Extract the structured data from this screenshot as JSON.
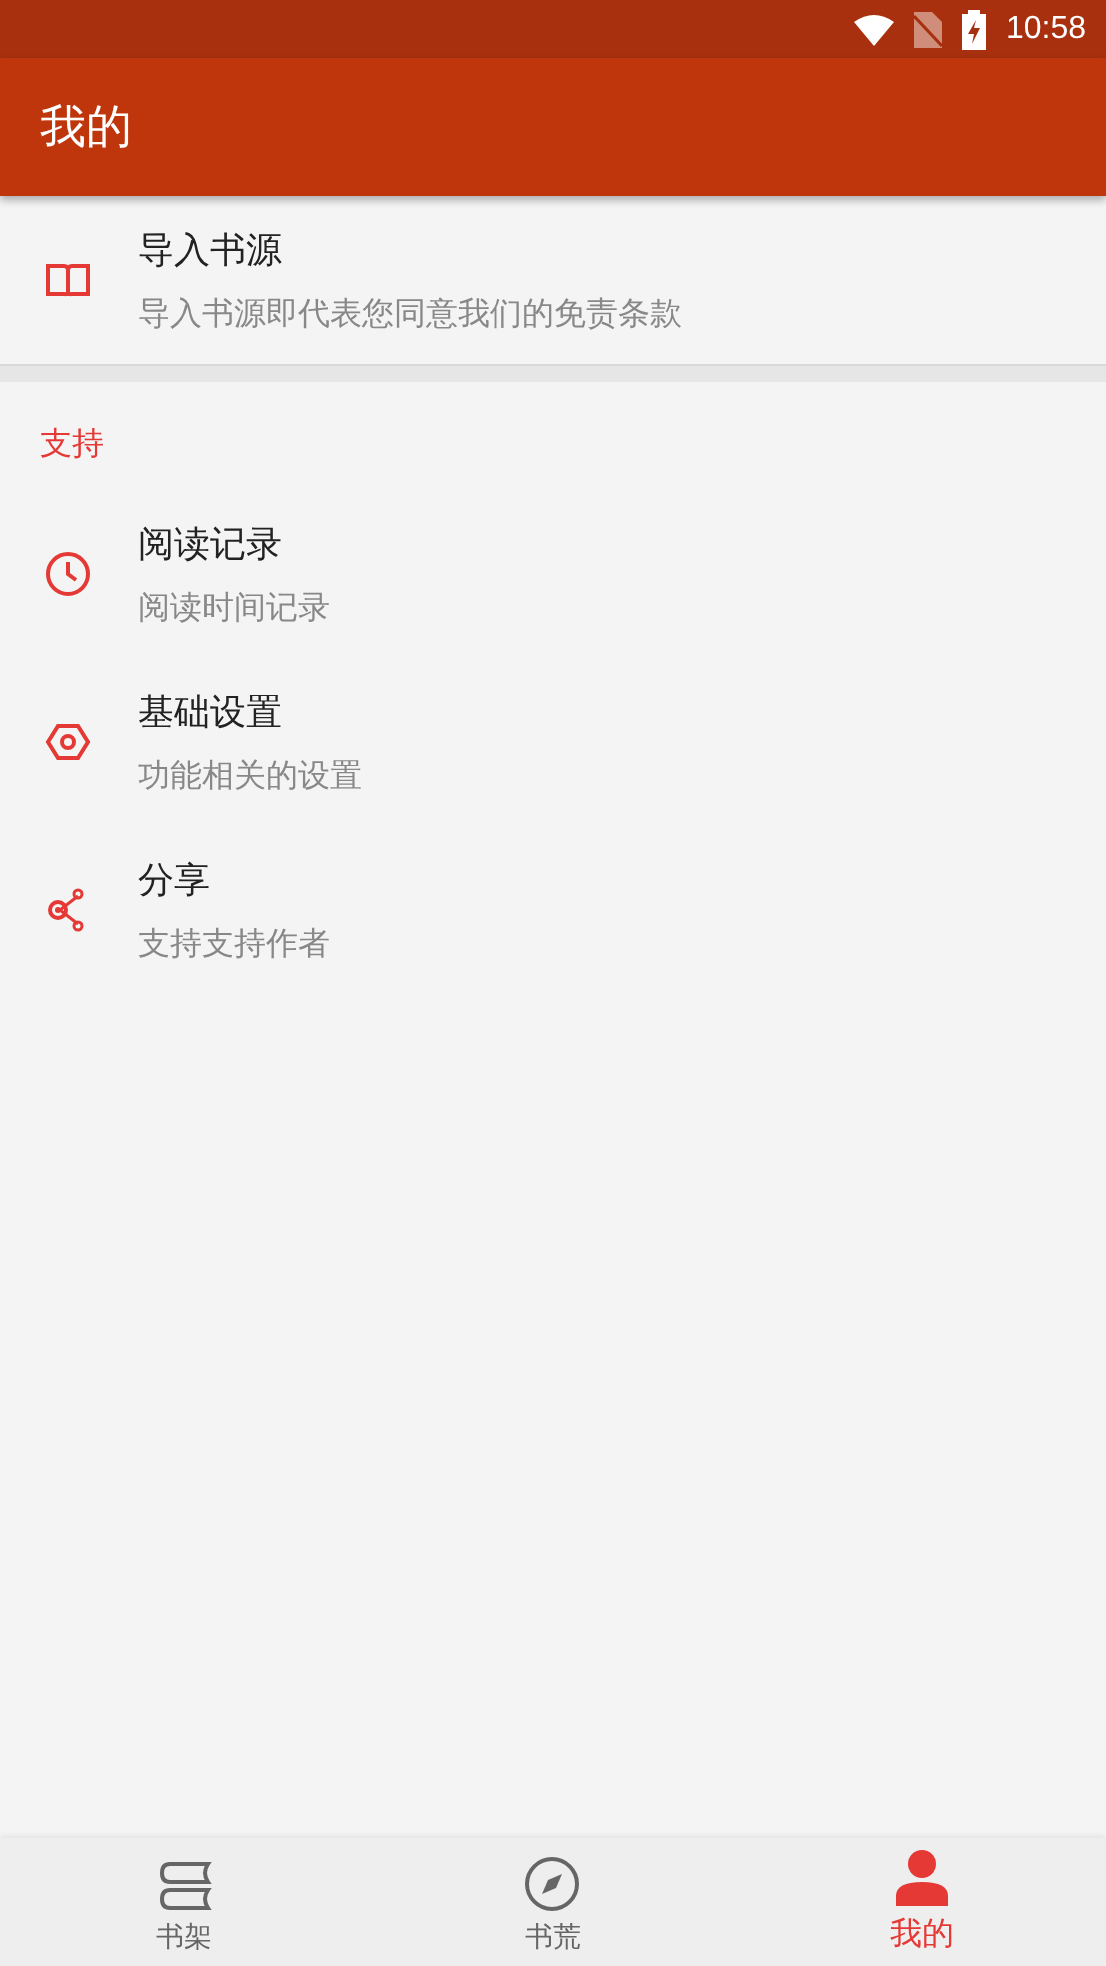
{
  "status_bar": {
    "time": "10:58"
  },
  "app_bar": {
    "title": "我的"
  },
  "top_items": [
    {
      "kind": "book",
      "title": "导入书源",
      "subtitle": "导入书源即代表您同意我们的免责条款"
    }
  ],
  "section": {
    "title": "支持",
    "items": [
      {
        "kind": "clock",
        "title": "阅读记录",
        "subtitle": "阅读时间记录"
      },
      {
        "kind": "hexagon",
        "title": "基础设置",
        "subtitle": "功能相关的设置"
      },
      {
        "kind": "share",
        "title": "分享",
        "subtitle": "支持支持作者"
      }
    ]
  },
  "bottom_nav": [
    {
      "kind": "books",
      "label": "书架",
      "selected": false
    },
    {
      "kind": "compass",
      "label": "书荒",
      "selected": false
    },
    {
      "kind": "person",
      "label": "我的",
      "selected": true
    }
  ]
}
